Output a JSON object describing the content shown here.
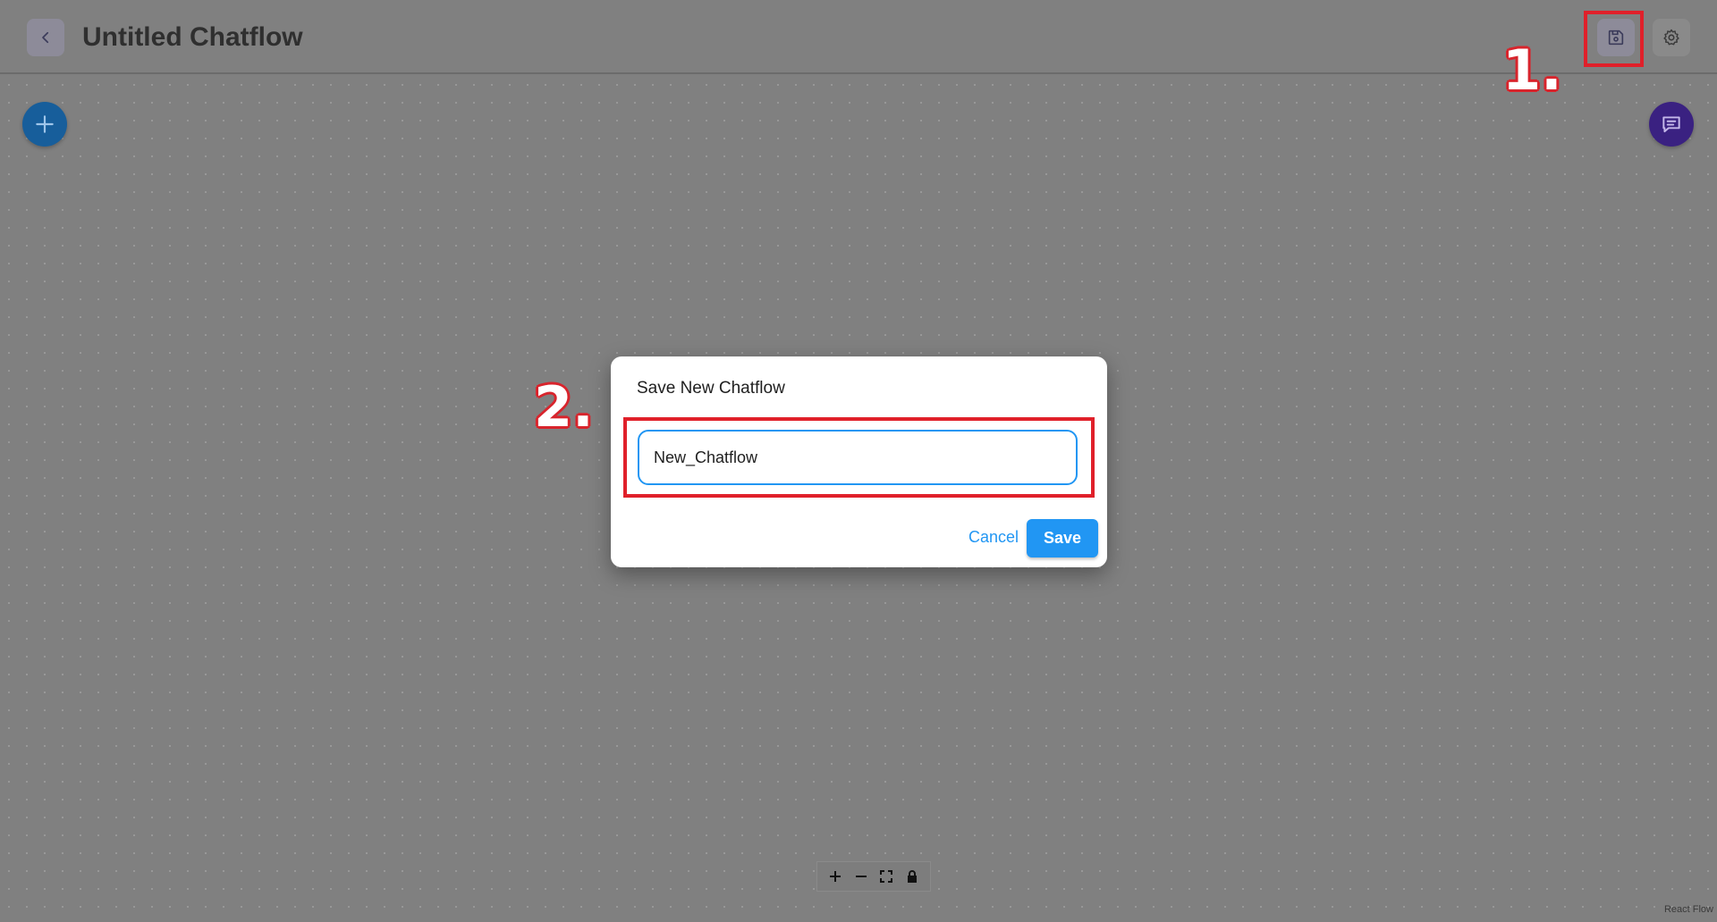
{
  "header": {
    "title": "Untitled Chatflow",
    "back_icon": "chevron-left-icon",
    "save_icon": "floppy-disk-icon",
    "settings_icon": "gear-icon"
  },
  "annotations": {
    "step1": "1.",
    "step2": "2.",
    "highlight_color": "#e0202a"
  },
  "canvas": {
    "add_icon": "plus-icon",
    "chat_icon": "chat-bubble-icon",
    "controls": [
      "zoom-in-icon",
      "zoom-out-icon",
      "fit-view-icon",
      "lock-icon"
    ],
    "attribution": "React Flow"
  },
  "dialog": {
    "title": "Save New Chatflow",
    "input_value": "New_Chatflow",
    "cancel_label": "Cancel",
    "save_label": "Save"
  },
  "colors": {
    "primary": "#2196f3",
    "add_button": "#175e9b",
    "chat_button": "#3a2181"
  }
}
